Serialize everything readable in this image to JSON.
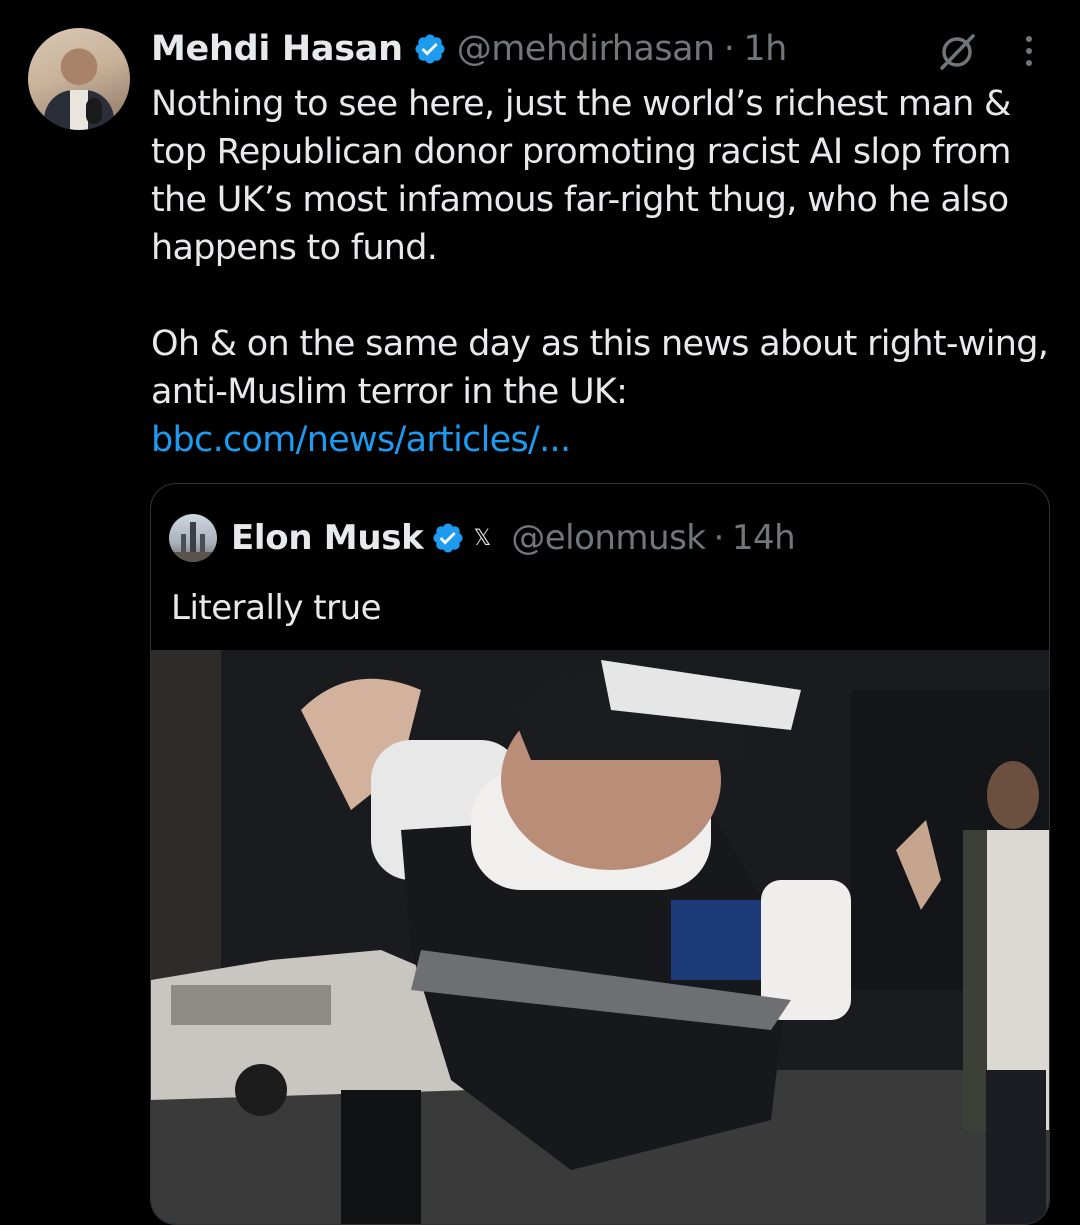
{
  "tweet": {
    "author_name": "Mehdi Hasan",
    "author_handle": "@mehdirhasan",
    "separator": "·",
    "time": "1h",
    "paragraph_1": "Nothing to see here, just the world’s richest man & top Republican donor promoting racist AI slop from the UK’s most infamous far-right thug, who he also happens to fund.",
    "paragraph_2": "Oh & on the same day as this news about right-wing, anti-Muslim terror in the UK:",
    "link_text": "bbc.com/news/articles/...",
    "icons": [
      "avatar",
      "verified-badge-icon",
      "grok-icon",
      "more-options-icon"
    ]
  },
  "quote": {
    "author_name": "Elon Musk",
    "affiliate_badge": "𝕏",
    "author_handle": "@elonmusk",
    "separator": "·",
    "time": "14h",
    "text": "Literally true",
    "icons": [
      "quote-avatar",
      "verified-badge-icon"
    ]
  },
  "colors": {
    "background": "#000000",
    "text_primary": "#e7e9ea",
    "text_secondary": "#71767b",
    "link": "#1d9bf0",
    "verified": "#1d9bf0",
    "border": "#2f3336"
  }
}
